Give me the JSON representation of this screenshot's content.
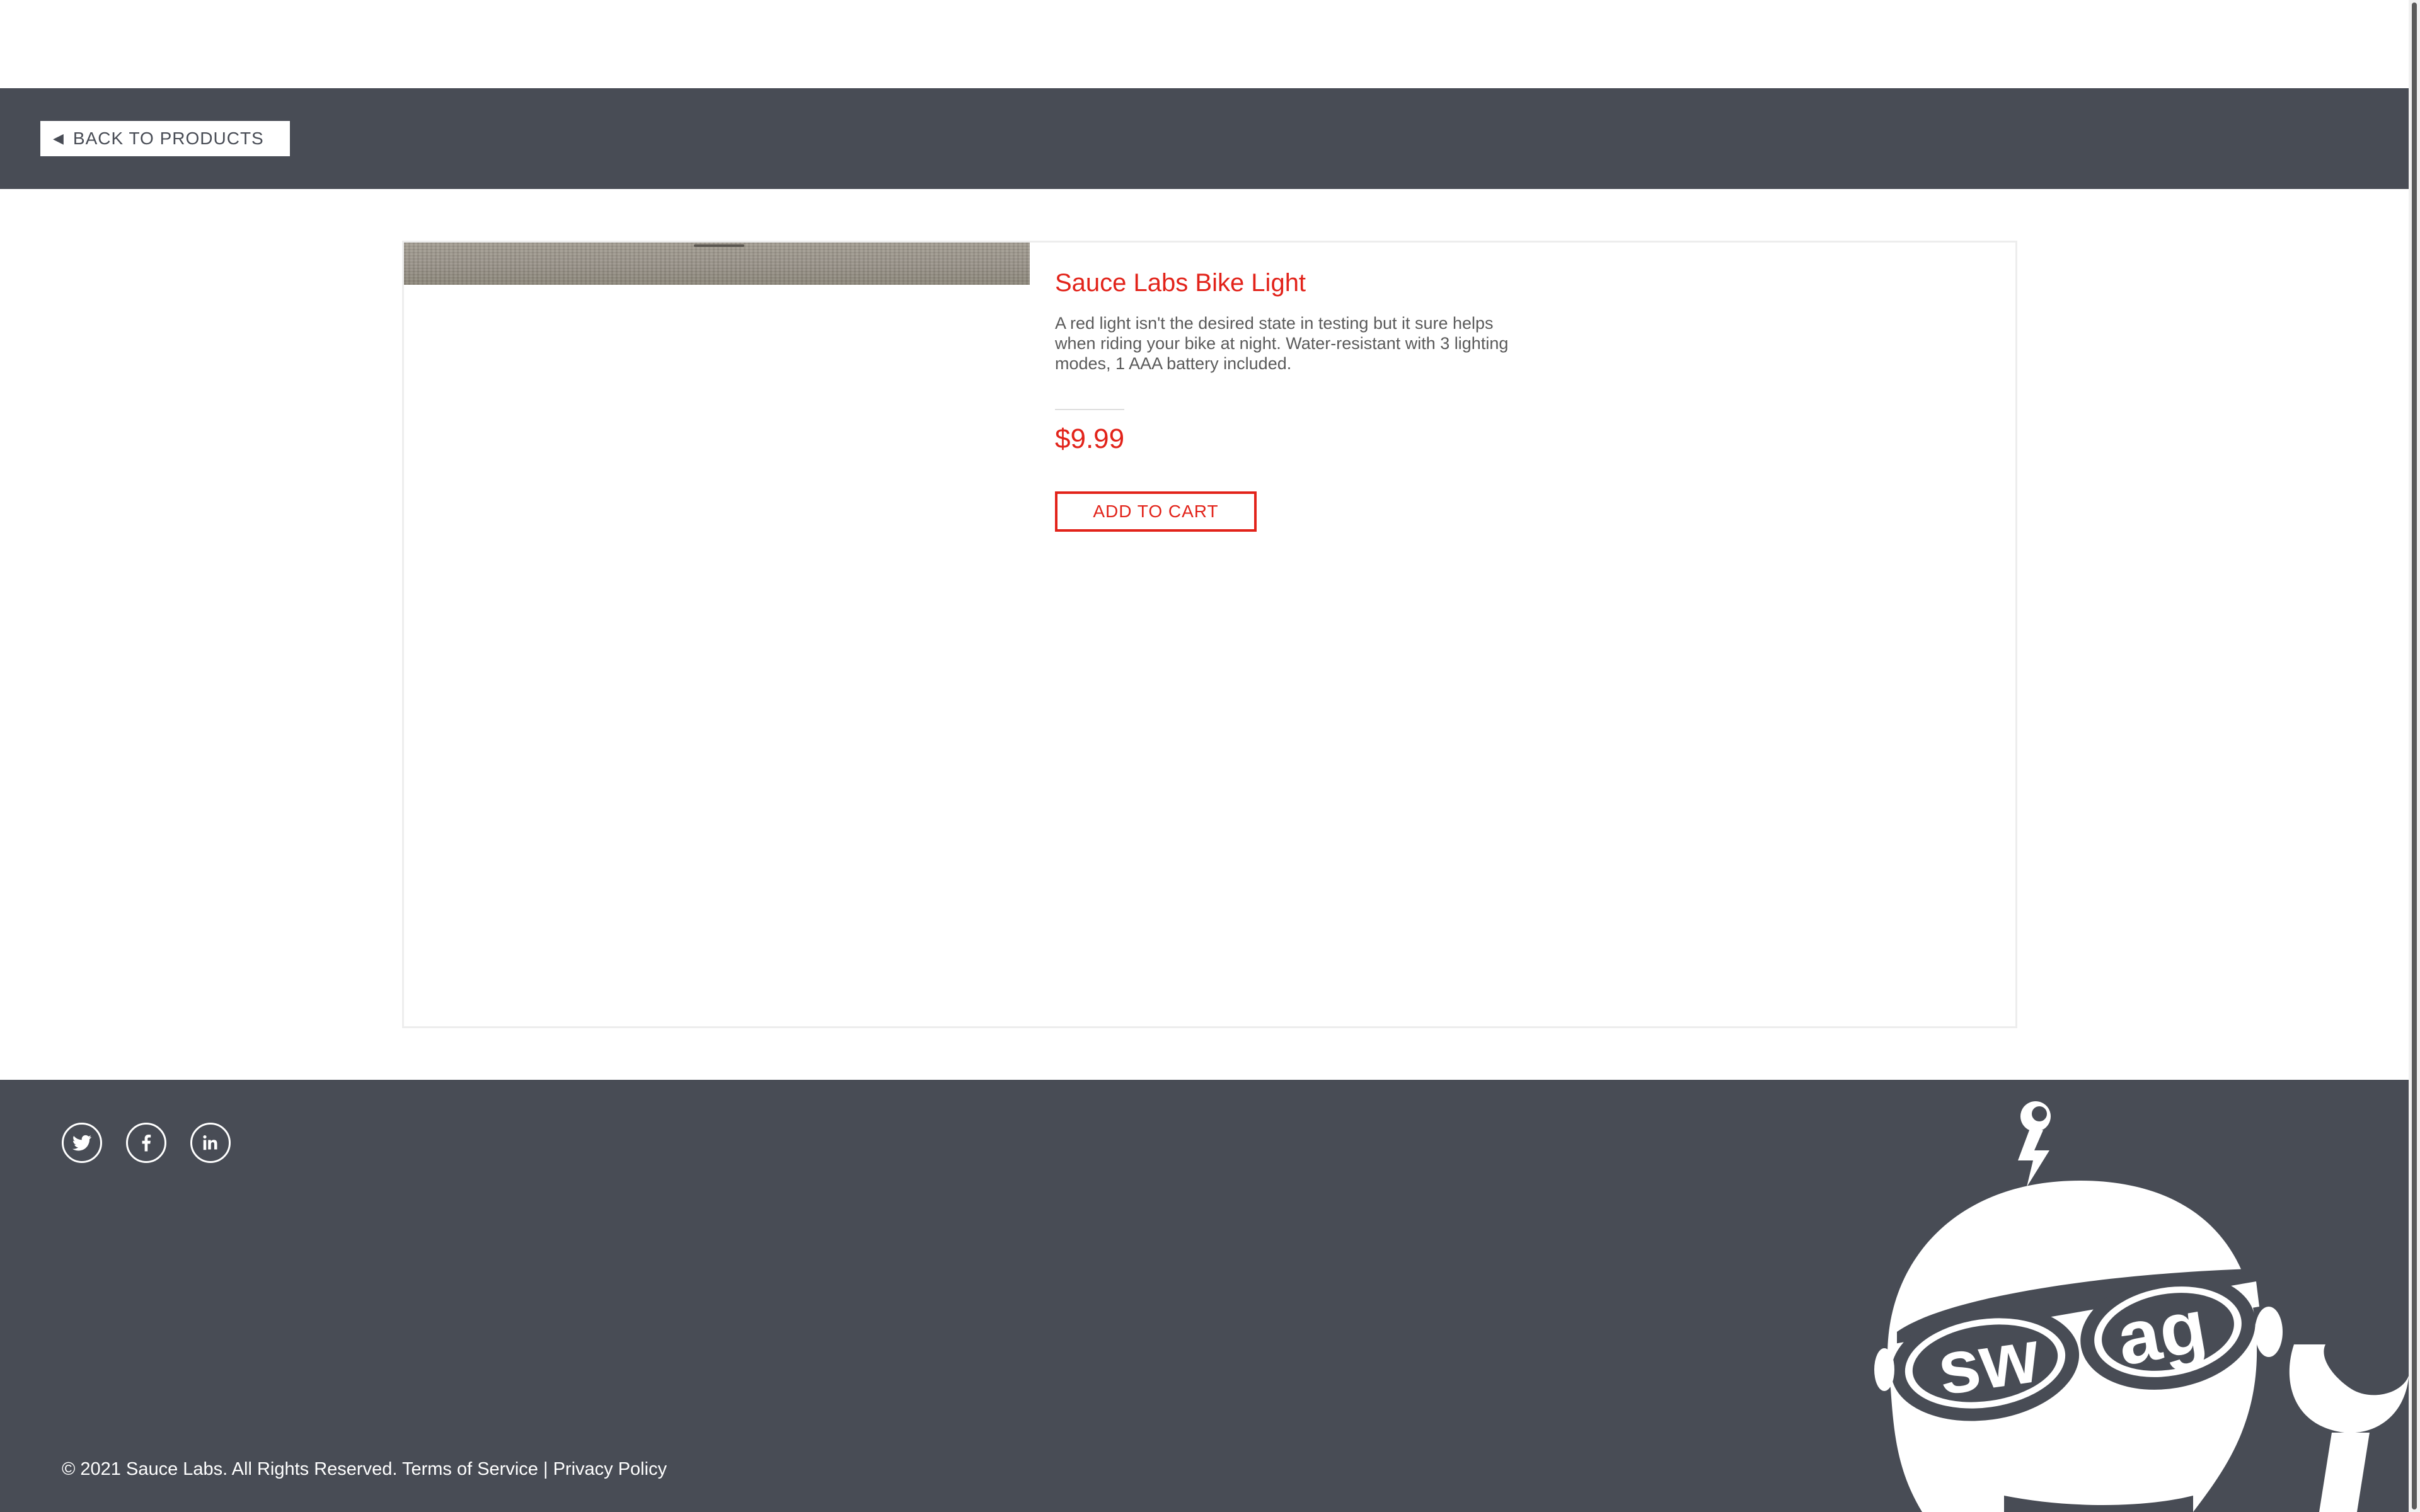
{
  "header": {
    "back_label": "BACK TO PRODUCTS"
  },
  "product": {
    "name": "Sauce Labs Bike Light",
    "description": "A red light isn't the desired state in testing but it sure helps when riding your bike at night. Water-resistant with 3 lighting modes, 1 AAA battery included.",
    "price": "$9.99",
    "add_to_cart_label": "ADD TO CART"
  },
  "footer": {
    "social": [
      "twitter-icon",
      "facebook-icon",
      "linkedin-icon"
    ],
    "copyright_text": "© 2021 Sauce Labs. All Rights Reserved.",
    "terms_label": "Terms of Service",
    "separator": "|",
    "privacy_label": "Privacy Policy",
    "logo_text_left": "sw",
    "logo_text_right": "ag"
  },
  "colors": {
    "accent": "#e2231a",
    "header_bg": "#484c55",
    "footer_bg": "#484c55"
  }
}
